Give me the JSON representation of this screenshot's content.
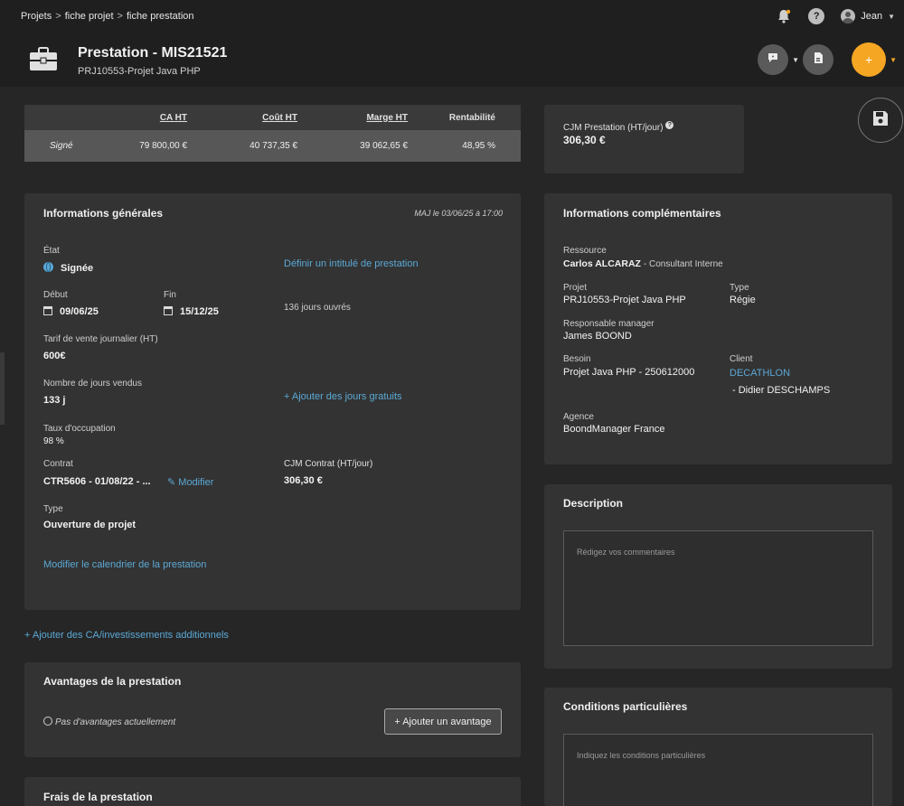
{
  "breadcrumb": [
    "Projets",
    "fiche projet",
    "fiche prestation"
  ],
  "user": {
    "name": "Jean"
  },
  "header": {
    "title": "Prestation - MIS21521",
    "subtitle": "PRJ10553-Projet Java PHP",
    "add_label": "+"
  },
  "finance": {
    "headers": [
      "CA HT",
      "Coût HT",
      "Marge HT",
      "Rentabilité"
    ],
    "row_label": "Signé",
    "values": [
      "79 800,00 €",
      "40 737,35 €",
      "39 062,65 €",
      "48,95 %"
    ]
  },
  "cjm_card": {
    "label": "CJM Prestation (HT/jour)",
    "value": "306,30 €"
  },
  "general": {
    "title": "Informations générales",
    "updated": "MAJ le 03/06/25 à 17:00",
    "etat_label": "État",
    "etat_value": "Signée",
    "define_title_link": "Définir un intitulé de prestation",
    "debut_label": "Début",
    "debut_value": "09/06/25",
    "fin_label": "Fin",
    "fin_value": "15/12/25",
    "working_days": "136 jours ouvrés",
    "tarif_label": "Tarif de vente journalier (HT)",
    "tarif_value": "600€",
    "jours_label": "Nombre de jours vendus",
    "jours_value": "133 j",
    "add_free_days": "+ Ajouter des jours gratuits",
    "taux_label": "Taux d'occupation",
    "taux_value": "98 %",
    "contrat_label": "Contrat",
    "contrat_value": "CTR5606 - 01/08/22 - ...",
    "modifier": "Modifier",
    "cjm_contrat_label": "CJM Contrat (HT/jour)",
    "cjm_contrat_value": "306,30 €",
    "type_label": "Type",
    "type_value": "Ouverture de projet",
    "calendar_link": "Modifier le calendrier de la prestation"
  },
  "add_ca_link": "+ Ajouter des CA/investissements additionnels",
  "advantages": {
    "title": "Avantages de la prestation",
    "empty": "Pas d'avantages actuellement",
    "add_button": "+ Ajouter un avantage"
  },
  "fees": {
    "title": "Frais de la prestation"
  },
  "complementary": {
    "title": "Informations complémentaires",
    "ressource_label": "Ressource",
    "ressource_value": "Carlos ALCARAZ",
    "ressource_role": "- Consultant Interne",
    "projet_label": "Projet",
    "projet_value": "PRJ10553-Projet Java PHP",
    "type_label": "Type",
    "type_value": "Régie",
    "manager_label": "Responsable manager",
    "manager_value": "James BOOND",
    "besoin_label": "Besoin",
    "besoin_value": "Projet Java PHP  - 250612000",
    "client_label": "Client",
    "client_value": "DECATHLON",
    "client_contact": "- Didier DESCHAMPS",
    "agence_label": "Agence",
    "agence_value": "BoondManager France"
  },
  "description": {
    "title": "Description",
    "placeholder": "Rédigez vos commentaires"
  },
  "conditions": {
    "title": "Conditions particulières",
    "placeholder": "Indiquez les conditions particulières"
  },
  "colors": {
    "accent": "#f5a623",
    "link": "#5ba9d6",
    "card": "#333333",
    "background": "#262626"
  }
}
